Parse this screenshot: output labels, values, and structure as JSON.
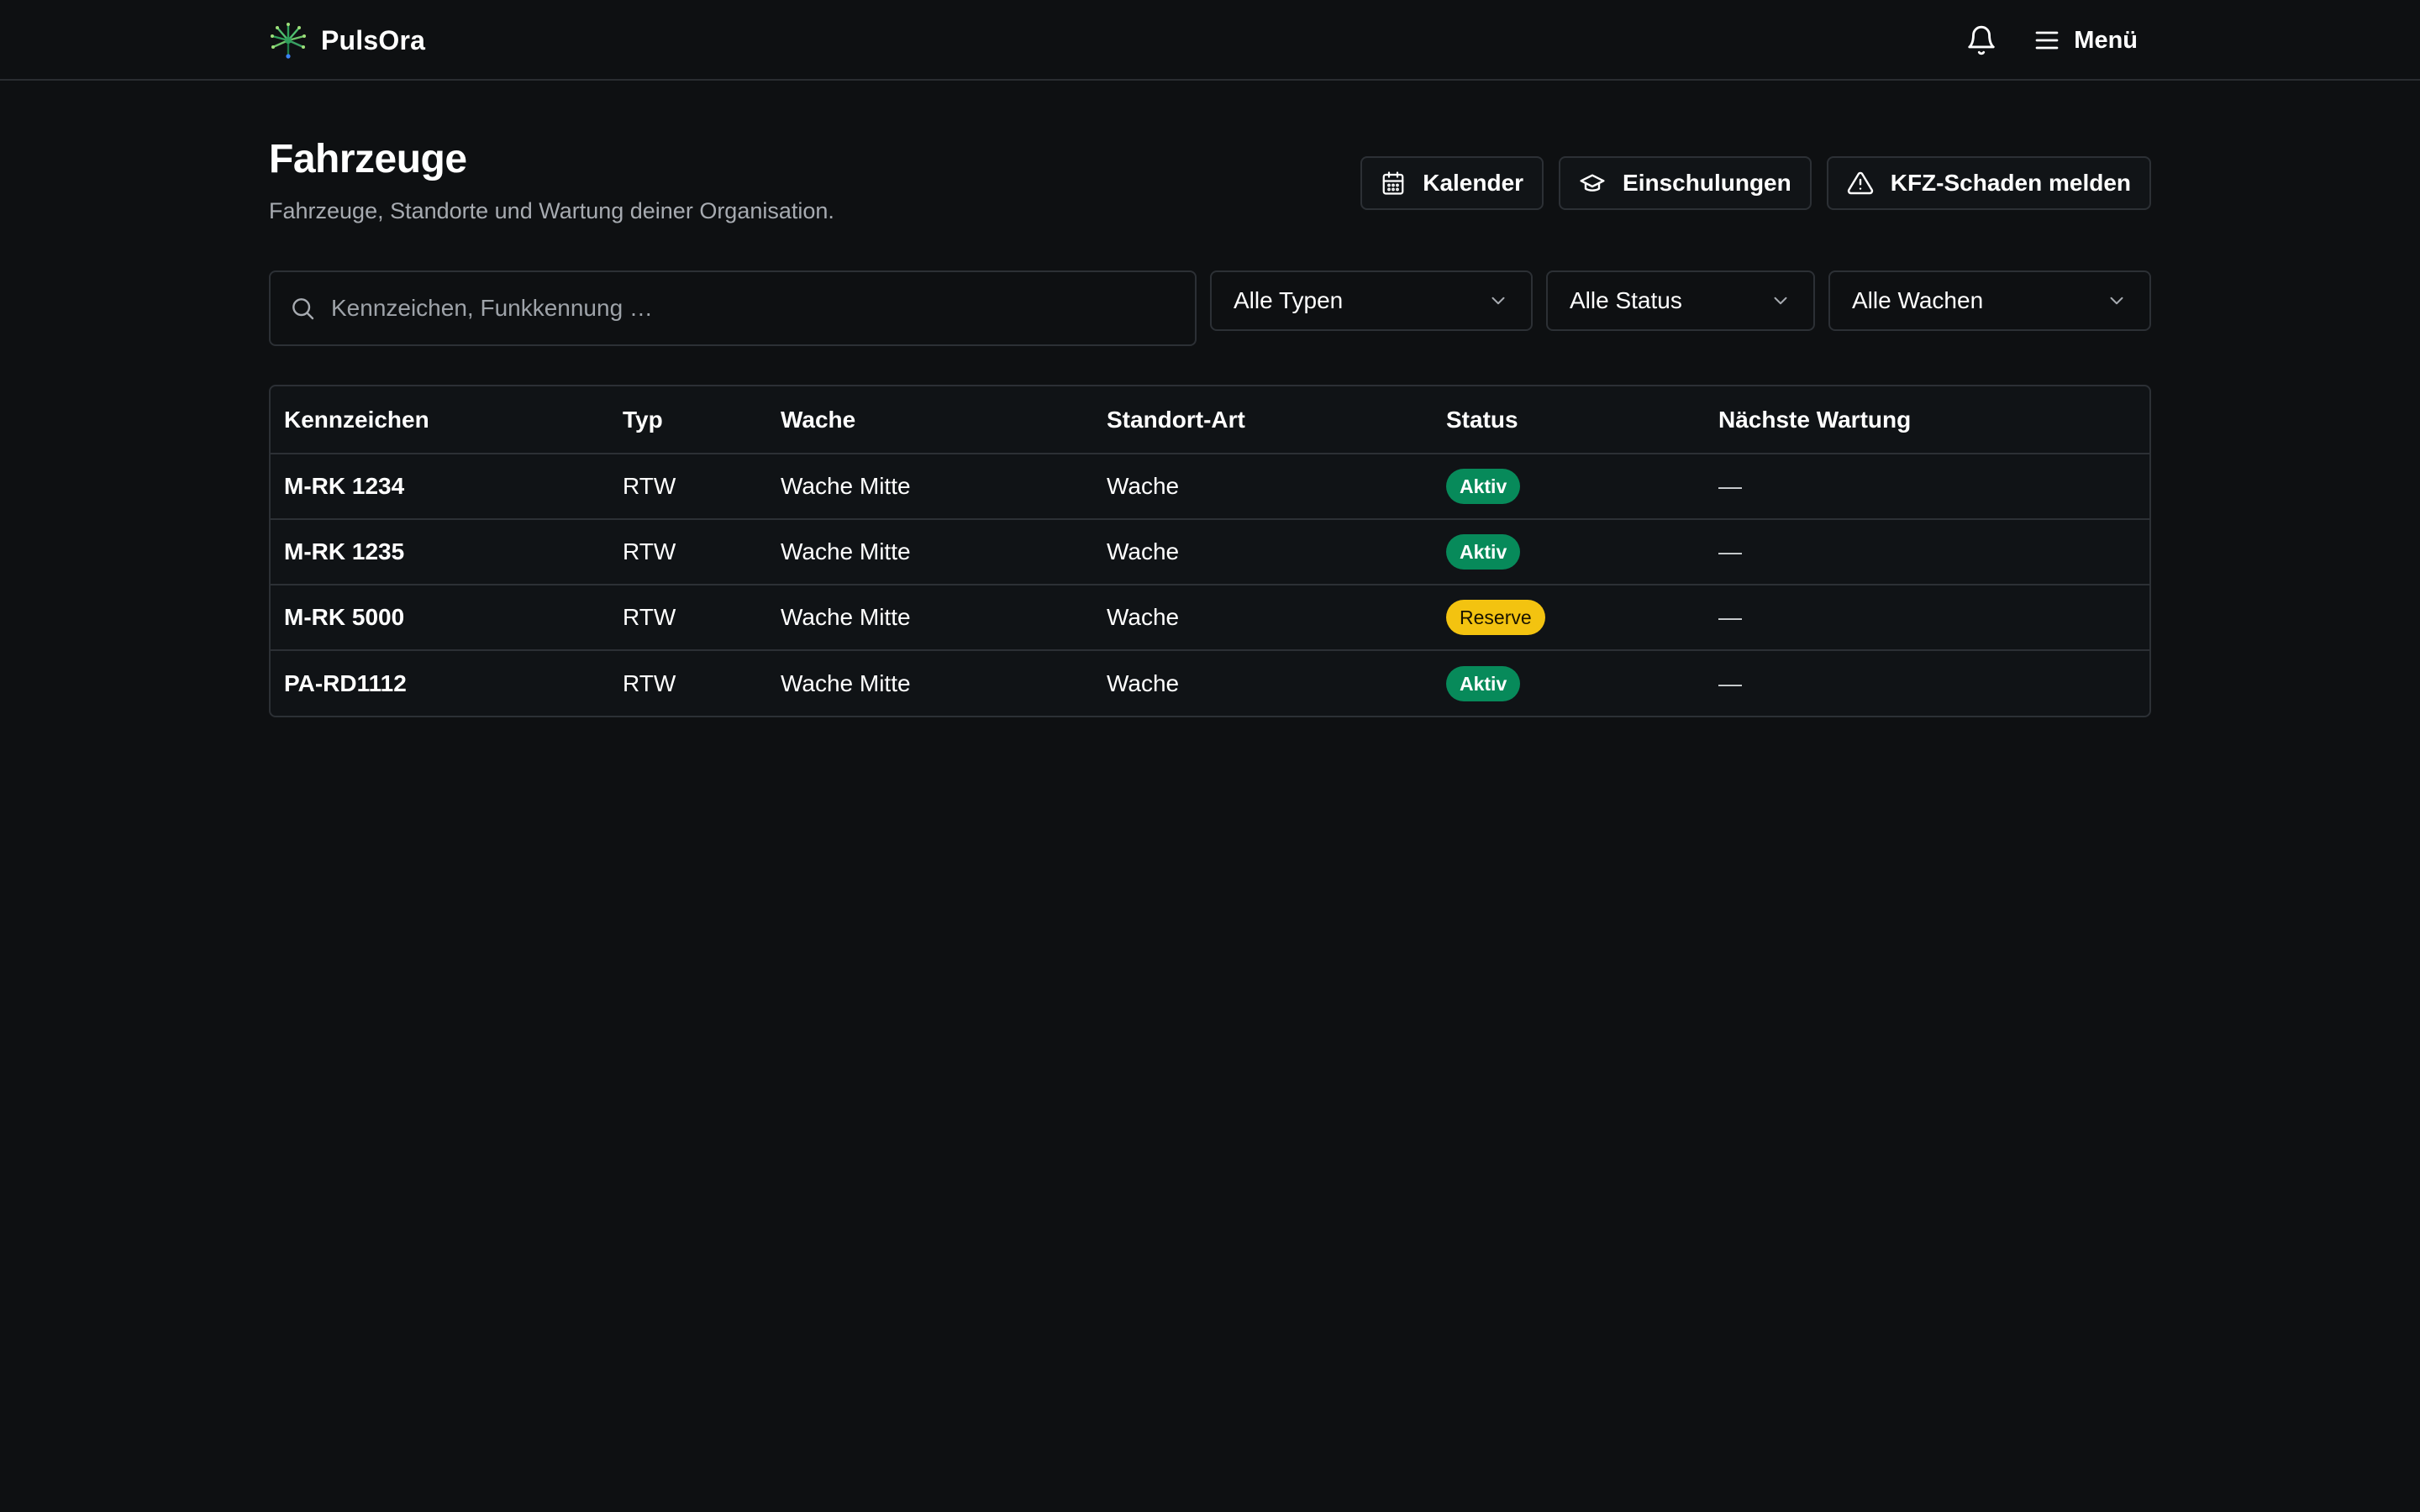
{
  "app": {
    "name": "PulsOra",
    "menu_label": "Menü",
    "icons": {
      "logo": "pulsora-logo-icon",
      "notifications": "bell-icon",
      "menu": "hamburger-icon"
    }
  },
  "page": {
    "title": "Fahrzeuge",
    "subtitle": "Fahrzeuge, Standorte und Wartung deiner Organisation."
  },
  "actions": {
    "calendar_label": "Kalender",
    "trainings_label": "Einschulungen",
    "report_damage_label": "KFZ-Schaden melden"
  },
  "filters": {
    "search_placeholder": "Kennzeichen, Funkkennung …",
    "search_value": "",
    "type_selected": "Alle Typen",
    "status_selected": "Alle Status",
    "station_selected": "Alle Wachen"
  },
  "table": {
    "columns": [
      "Kennzeichen",
      "Typ",
      "Wache",
      "Standort-Art",
      "Status",
      "Nächste Wartung"
    ],
    "rows": [
      {
        "plate": "M-RK 1234",
        "type": "RTW",
        "station": "Wache Mitte",
        "location_type": "Wache",
        "status": "Aktiv",
        "status_kind": "aktiv",
        "next_service": "—"
      },
      {
        "plate": "M-RK 1235",
        "type": "RTW",
        "station": "Wache Mitte",
        "location_type": "Wache",
        "status": "Aktiv",
        "status_kind": "aktiv",
        "next_service": "—"
      },
      {
        "plate": "M-RK 5000",
        "type": "RTW",
        "station": "Wache Mitte",
        "location_type": "Wache",
        "status": "Reserve",
        "status_kind": "reserve",
        "next_service": "—"
      },
      {
        "plate": "PA-RD1112",
        "type": "RTW",
        "station": "Wache Mitte",
        "location_type": "Wache",
        "status": "Aktiv",
        "status_kind": "aktiv",
        "next_service": "—"
      }
    ]
  },
  "colors": {
    "background": "#0e1012",
    "border": "#2c3035",
    "status_aktiv": "#078a5a",
    "status_reserve": "#f3c310",
    "muted_text": "#a7abb1"
  }
}
